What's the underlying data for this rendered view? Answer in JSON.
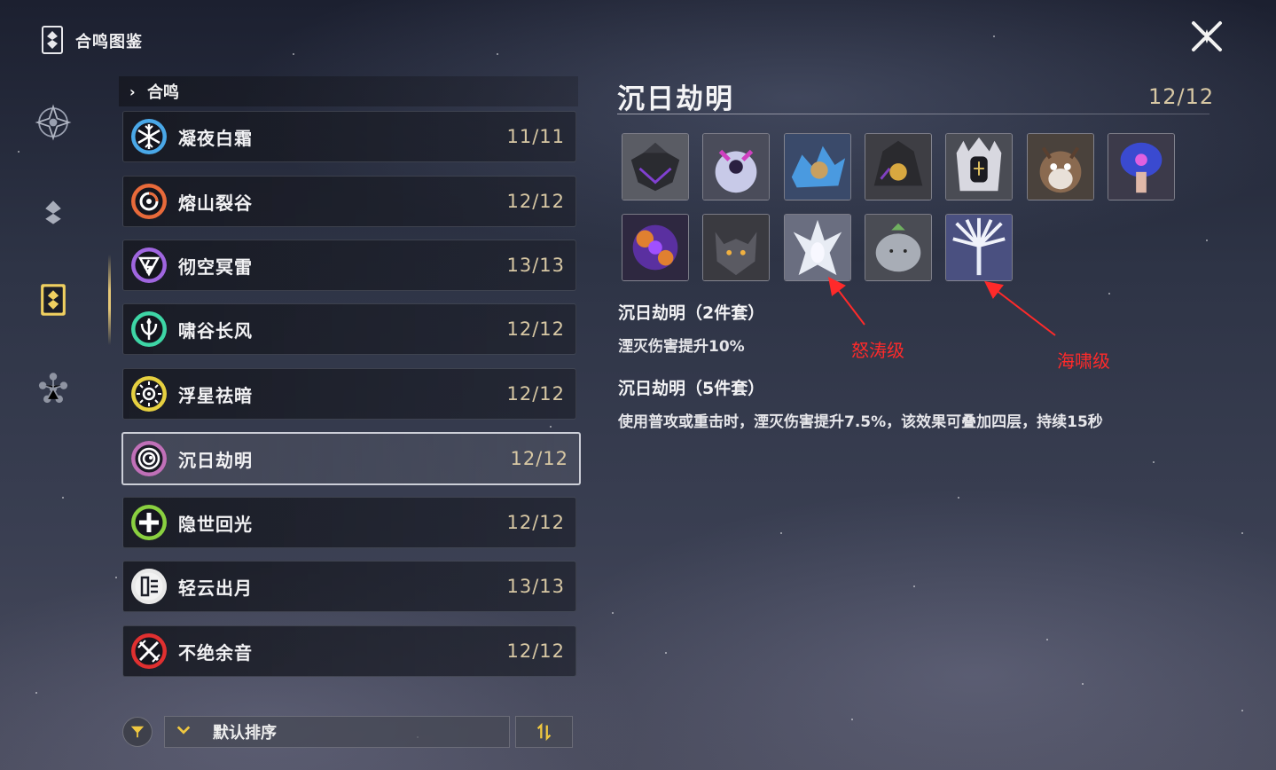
{
  "header": {
    "title": "合鸣图鉴",
    "close_icon": "close-x-icon"
  },
  "rail": {
    "items": [
      {
        "icon": "star-emblem-icon"
      },
      {
        "icon": "echo-stack-icon"
      },
      {
        "icon": "sonata-card-icon",
        "selected": true
      },
      {
        "icon": "molecule-icon"
      }
    ]
  },
  "list": {
    "section_label": "合鸣",
    "sets": [
      {
        "name": "凝夜白霜",
        "count": "11/11",
        "icon": "snowflake-icon",
        "color": "#4aa8e8"
      },
      {
        "name": "熔山裂谷",
        "count": "12/12",
        "icon": "flame-swirl-icon",
        "color": "#e86a3a"
      },
      {
        "name": "彻空冥雷",
        "count": "13/13",
        "icon": "thunder-icon",
        "color": "#a066e0"
      },
      {
        "name": "啸谷长风",
        "count": "12/12",
        "icon": "wind-icon",
        "color": "#3ed6a6"
      },
      {
        "name": "浮星祛暗",
        "count": "12/12",
        "icon": "sun-icon",
        "color": "#e6d040"
      },
      {
        "name": "沉日劫明",
        "count": "12/12",
        "icon": "havoc-spiral-icon",
        "color": "#c070b8",
        "selected": true
      },
      {
        "name": "隐世回光",
        "count": "12/12",
        "icon": "heal-plus-icon",
        "color": "#8ad040"
      },
      {
        "name": "轻云出月",
        "count": "13/13",
        "icon": "moon-cloud-icon",
        "color": "#e8e8e8"
      },
      {
        "name": "不绝余音",
        "count": "12/12",
        "icon": "sword-cross-icon",
        "color": "#e03030"
      }
    ]
  },
  "footer": {
    "filter_icon": "funnel-icon",
    "sort_label": "默认排序",
    "order_icon": "sort-toggle-icon"
  },
  "detail": {
    "title": "沉日劫明",
    "count": "12/12",
    "echoes": [
      {
        "icon": "echo-dark-crown-icon"
      },
      {
        "icon": "echo-purple-orb-icon"
      },
      {
        "icon": "echo-crystal-icon"
      },
      {
        "icon": "echo-dark-gold-icon"
      },
      {
        "icon": "echo-white-crowned-icon"
      },
      {
        "icon": "echo-owl-icon"
      },
      {
        "icon": "echo-mushroom-icon"
      },
      {
        "icon": "echo-purple-bloom-icon"
      },
      {
        "icon": "echo-wolf-icon"
      },
      {
        "icon": "echo-white-spirit-icon"
      },
      {
        "icon": "echo-grey-blob-icon"
      },
      {
        "icon": "echo-white-tree-icon"
      }
    ],
    "bonus2_title": "沉日劫明（2件套）",
    "bonus2_desc": "湮灭伤害提升10%",
    "bonus5_title": "沉日劫明（5件套）",
    "bonus5_desc": "使用普攻或重击时，湮灭伤害提升7.5%，该效果可叠加四层，持续15秒"
  },
  "annotations": {
    "a1": "怒涛级",
    "a2": "海啸级",
    "color": "#ff2a2a"
  }
}
